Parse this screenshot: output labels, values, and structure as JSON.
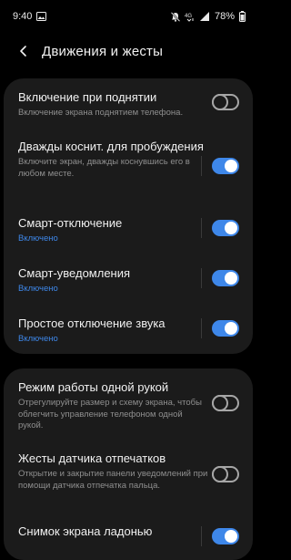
{
  "status_bar": {
    "time": "9:40",
    "battery": "78%",
    "network": "4G"
  },
  "header": {
    "title": "Движения и жесты"
  },
  "sections": [
    {
      "items": [
        {
          "title": "Включение при поднятии",
          "description": "Включение экрана поднятием телефона.",
          "status": "",
          "enabled": false
        },
        {
          "title": "Дважды коснит. для пробуждения",
          "description": "Включите экран, дважды коснувшись его в любом месте.",
          "status": "",
          "enabled": true
        },
        {
          "title": "Смарт-отключение",
          "description": "",
          "status": "Включено",
          "enabled": true
        },
        {
          "title": "Смарт-уведомления",
          "description": "",
          "status": "Включено",
          "enabled": true
        },
        {
          "title": "Простое отключение звука",
          "description": "",
          "status": "Включено",
          "enabled": true
        }
      ]
    },
    {
      "items": [
        {
          "title": "Режим работы одной рукой",
          "description": "Отрегулируйте размер и схему экрана, чтобы облегчить управление телефоном одной рукой.",
          "status": "",
          "enabled": false
        },
        {
          "title": "Жесты датчика отпечатков",
          "description": "Открытие и закрытие панели уведомлений при помощи датчика отпечатка пальца.",
          "status": "",
          "enabled": false
        },
        {
          "title": "Снимок экрана ладонью",
          "description": "",
          "status": "",
          "enabled": true
        }
      ]
    }
  ],
  "colors": {
    "accent": "#3e87e9",
    "background": "#000000",
    "card": "#1b1b1b",
    "secondary_text": "#8f8f8f"
  }
}
